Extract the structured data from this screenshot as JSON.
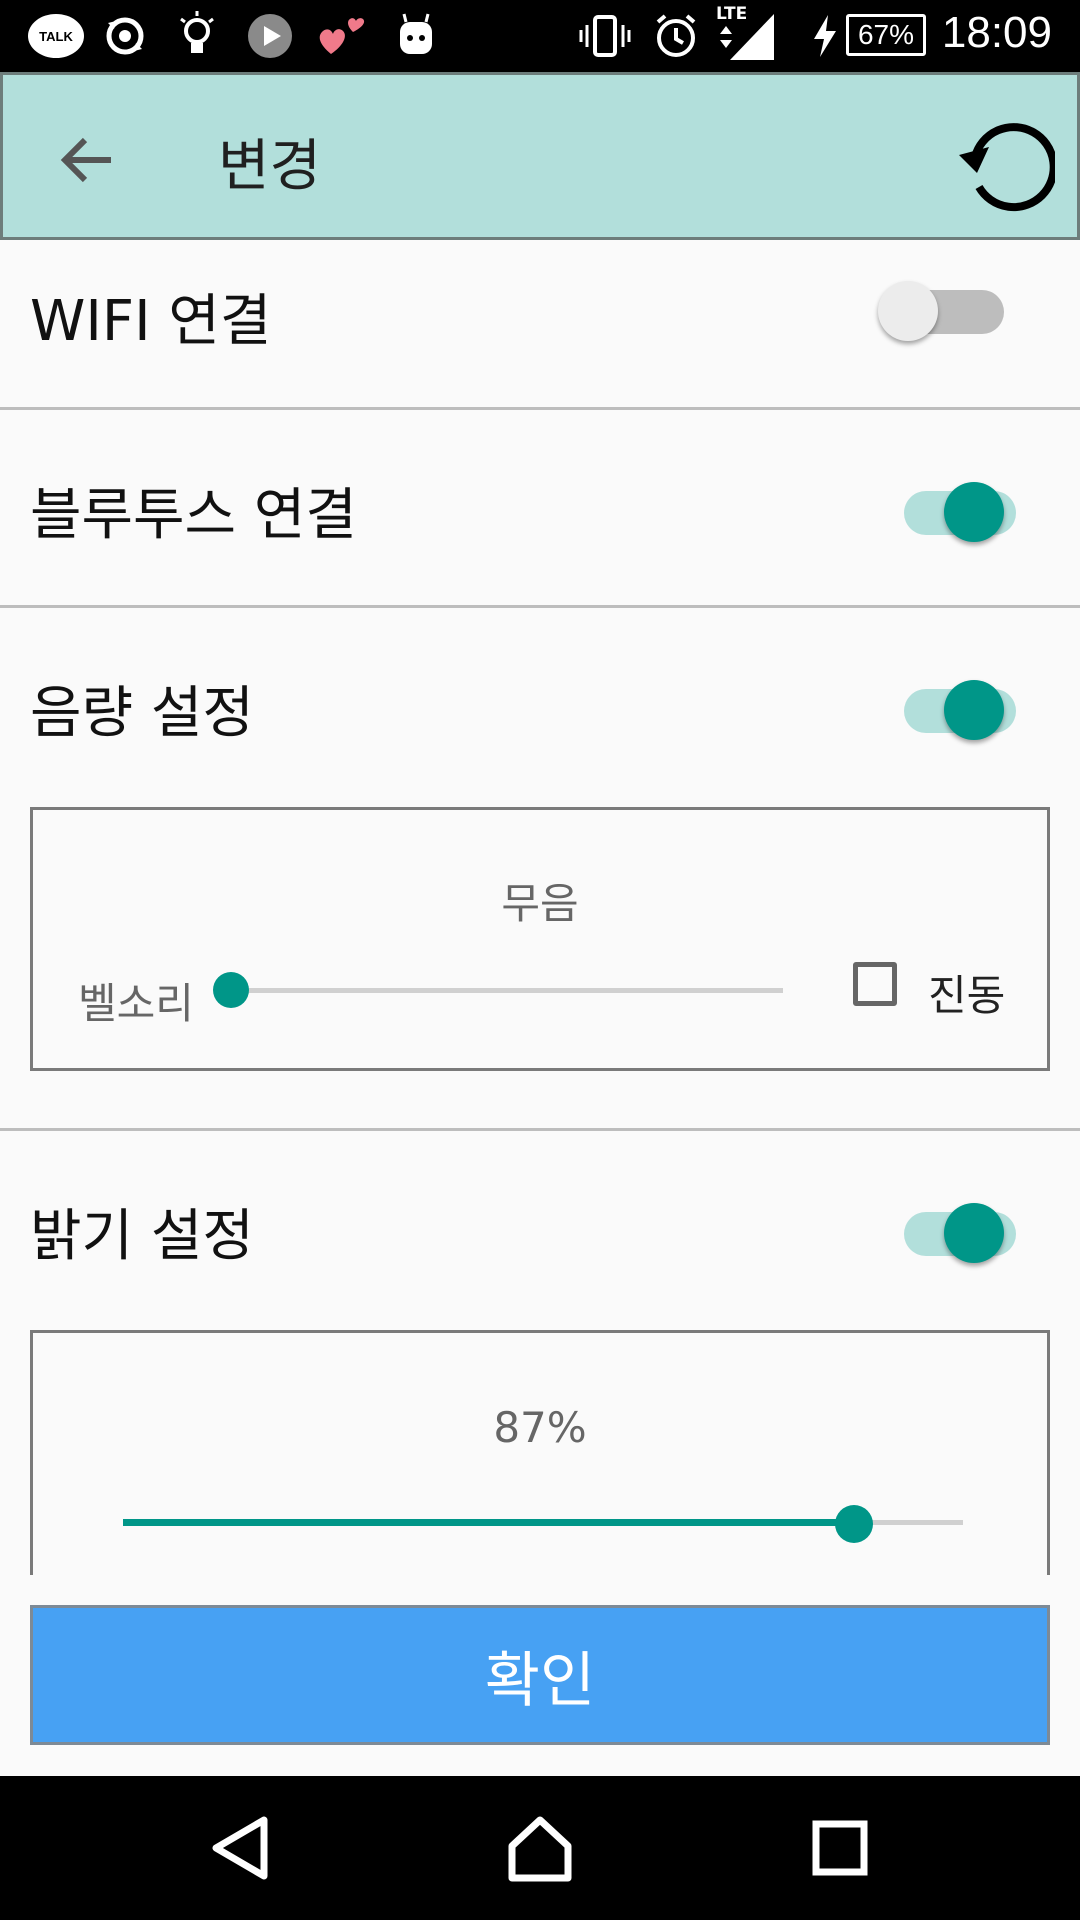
{
  "status_bar": {
    "app_icons": [
      "kakaotalk-icon",
      "sync-icon",
      "lightbulb-icon",
      "play-icon",
      "hearts-icon",
      "robot-icon"
    ],
    "talk_label": "TALK",
    "network_label": "LTE",
    "battery": "67%",
    "time": "18:09"
  },
  "app_bar": {
    "title": "변경",
    "background": "#b2dfdb"
  },
  "settings": {
    "wifi": {
      "label": "WIFI 연결",
      "enabled": false
    },
    "bluetooth": {
      "label": "블루투스 연결",
      "enabled": true
    },
    "volume": {
      "label": "음량 설정",
      "enabled": true,
      "status": "무음",
      "ringtone_label": "벨소리",
      "ringtone_level": 0,
      "vibrate_label": "진동",
      "vibrate_checked": false
    },
    "brightness": {
      "label": "밝기 설정",
      "enabled": true,
      "value_text": "87%",
      "level": 0.87
    }
  },
  "confirm_button": {
    "label": "확인",
    "color": "#47a1f3"
  },
  "colors": {
    "accent": "#009688",
    "accent_light": "#b2dfdb"
  },
  "nav_bar": {
    "buttons": [
      "back-icon",
      "home-icon",
      "recents-icon"
    ]
  }
}
